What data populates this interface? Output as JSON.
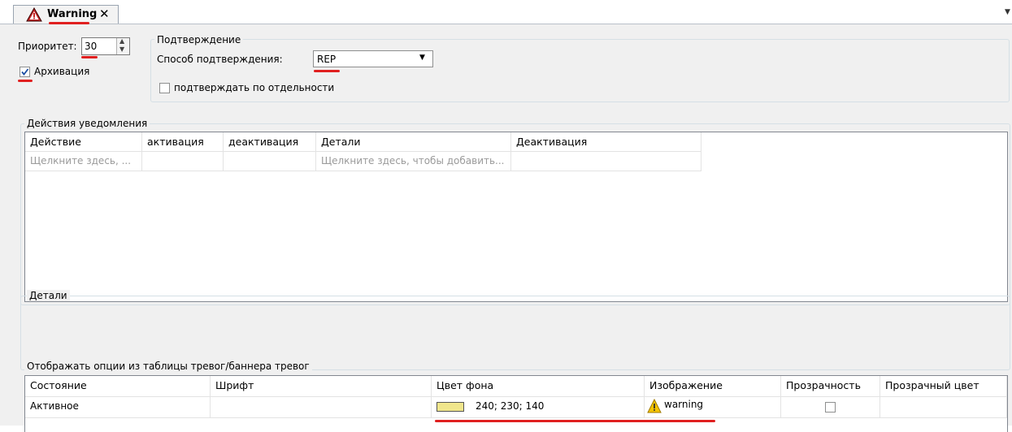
{
  "tab": {
    "title": "Warning",
    "close": "✕",
    "icon": "warning-triangle-icon"
  },
  "priority": {
    "label": "Приоритет:",
    "value": "30"
  },
  "archive": {
    "label": "Архивация",
    "checked": true
  },
  "confirm": {
    "group_title": "Подтверждение",
    "method_label": "Способ подтверждения:",
    "method_value": "REP",
    "separately_label": "подтверждать по отдельности",
    "separately_checked": false
  },
  "actions": {
    "group_title": "Действия уведомления",
    "columns": [
      "Действие",
      "активация",
      "деактивация",
      "Детали",
      "Деактивация"
    ],
    "placeholder_row": [
      "Щелкните здесь, ...",
      "",
      "",
      "Щелкните здесь, чтобы добавить...",
      ""
    ]
  },
  "details": {
    "group_title": "Детали"
  },
  "display": {
    "group_title": "Отображать опции из таблицы тревог/баннера тревог",
    "columns": [
      "Состояние",
      "Шрифт",
      "Цвет фона",
      "Изображение",
      "Прозрачность",
      "Прозрачный цвет"
    ],
    "row": {
      "state": "Активное",
      "font": "",
      "bg_color_text": "240; 230; 140",
      "bg_color_hex": "#f0e68c",
      "image": "warning",
      "transparency": false,
      "transparent_color": ""
    }
  }
}
